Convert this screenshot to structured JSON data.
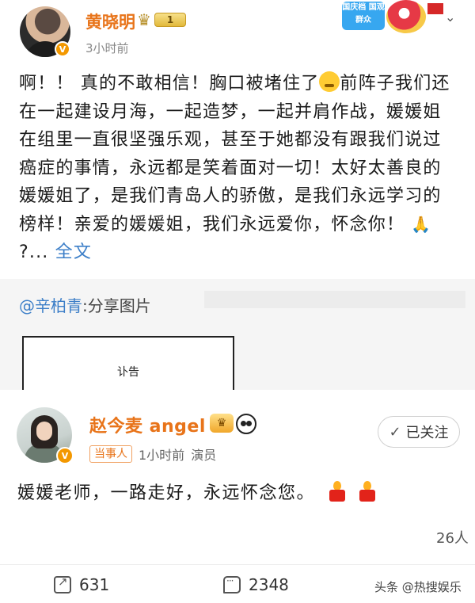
{
  "post1": {
    "author": "黄晓明",
    "level_badge": "1",
    "time": "3小时前",
    "promo_tag": "国庆档 国观群众",
    "body_parts": [
      "啊！！ 真的不敢相信！胸口被堵住了",
      "前阵子我们还在一起建设月海，一起造梦，一起并肩作战，媛媛姐在组里一直很坚强乐观，甚至于她都没有跟我们说过癌症的事情，永远都是笑着面对一切！太好太善良的媛媛姐了，是我们青岛人的骄傲，是我们永远学习的榜样！亲爱的媛媛姐，我们永远爱你，怀念你！",
      "?... "
    ],
    "expand_label": "全文",
    "repost": {
      "mention": "@辛柏青",
      "suffix": ":分享图片",
      "image_title": "讣告"
    }
  },
  "post2": {
    "author": "赵今麦 angel",
    "follow_label": "已关注",
    "party_tag": "当事人",
    "time": "1小时前",
    "role": "演员",
    "body": "媛媛老师，一路走好，永远怀念您。",
    "likes": "26人",
    "shares": "631",
    "comments": "2348",
    "watermark": "头条 @热搜娱乐"
  },
  "colors": {
    "name_orange": "#e8741a",
    "link_blue": "#3d7fc8",
    "verified_badge": "#f39800"
  }
}
